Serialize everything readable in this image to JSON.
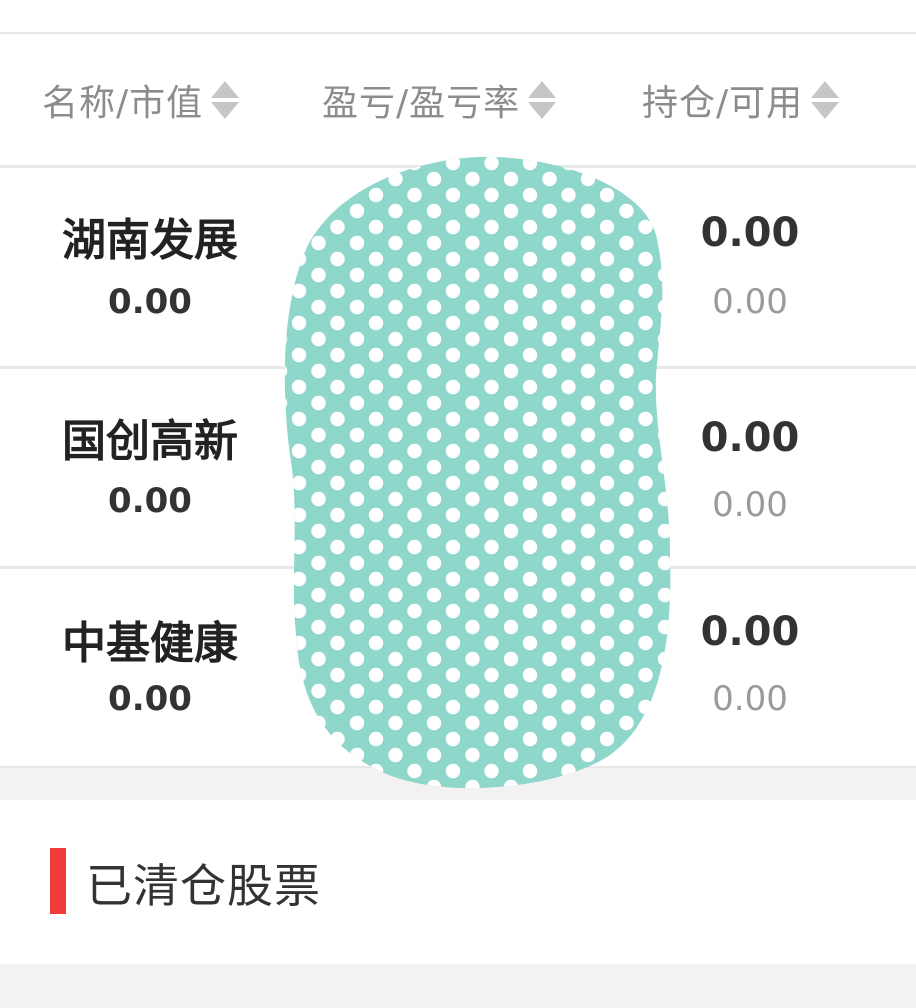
{
  "colors": {
    "accent_bar": "#ef3b3b",
    "redaction_fill": "#8fd6cb",
    "redaction_dot": "#ffffff",
    "divider": "#e8e8e8",
    "gap_background": "#f2f2f2"
  },
  "header": {
    "col_name_label": "名称/市值",
    "col_pl_label": "盈亏/盈亏率",
    "col_pos_label": "持仓/可用",
    "sort_icon": "sort-up-down-icon"
  },
  "holdings": [
    {
      "name": "湖南发展",
      "market_value": "0.00",
      "position": "0.00",
      "available": "0.00"
    },
    {
      "name": "国创高新",
      "market_value": "0.00",
      "position": "0.00",
      "available": "0.00"
    },
    {
      "name": "中基健康",
      "market_value": "0.00",
      "position": "0.00",
      "available": "0.00"
    }
  ],
  "cleared_section": {
    "title": "已清仓股票"
  }
}
